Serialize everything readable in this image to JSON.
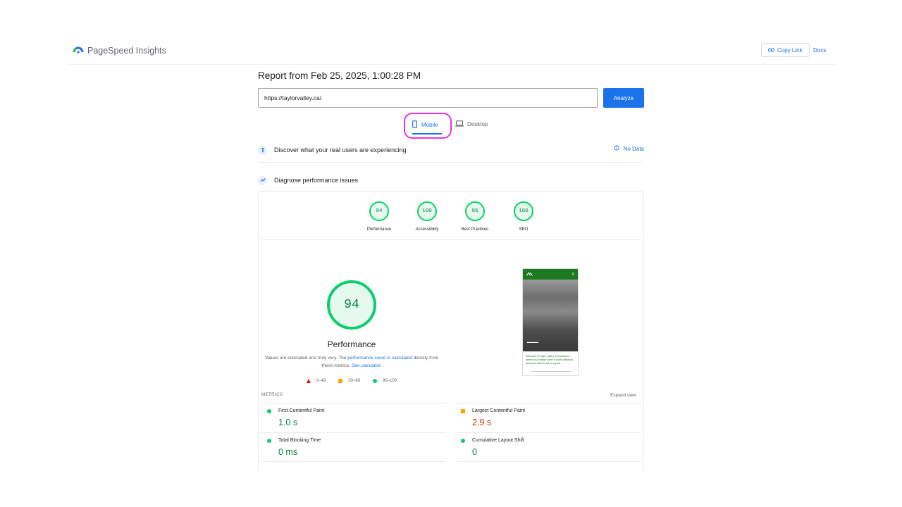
{
  "header": {
    "brand": "PageSpeed Insights",
    "copy_link": "Copy Link",
    "docs": "Docs"
  },
  "report": {
    "title": "Report from Feb 25, 2025, 1:00:28 PM",
    "url": "https://taylorvalley.ca/",
    "analyze": "Analyze"
  },
  "tabs": {
    "mobile": "Mobile",
    "desktop": "Desktop"
  },
  "sections": {
    "real_users": "Discover what your real users are experiencing",
    "no_data": "No Data",
    "diagnose": "Diagnose performance issues"
  },
  "scores": [
    {
      "value": "94",
      "label": "Performance"
    },
    {
      "value": "100",
      "label": "Accessibility"
    },
    {
      "value": "96",
      "label": "Best Practices"
    },
    {
      "value": "100",
      "label": "SEO"
    }
  ],
  "performance": {
    "score": "94",
    "label": "Performance",
    "note_1": "Values are estimated and may vary. The ",
    "note_link_1": "performance score is calculated",
    "note_2": " directly from these metrics. ",
    "note_link_2": "See calculator."
  },
  "legend": {
    "fail": "0–49",
    "average": "50–89",
    "pass": "90–100"
  },
  "phone": {
    "caption": "Welcome to Taylor Valley. Construction, where your dream home is worth attention and all of mind is put to a good."
  },
  "metrics": {
    "label": "METRICS",
    "expand": "Expand view",
    "fcp": {
      "name": "First Contentful Paint",
      "value": "1.0 s"
    },
    "lcp": {
      "name": "Largest Contentful Paint",
      "value": "2.9 s"
    },
    "tbt": {
      "name": "Total Blocking Time",
      "value": "0 ms"
    },
    "cls": {
      "name": "Cumulative Layout Shift",
      "value": "0"
    }
  },
  "colors": {
    "pass": "#0cce6b",
    "average": "#ffa400",
    "fail": "#eb0f00",
    "accent": "#1a73e8",
    "highlight": "#e535e5"
  }
}
